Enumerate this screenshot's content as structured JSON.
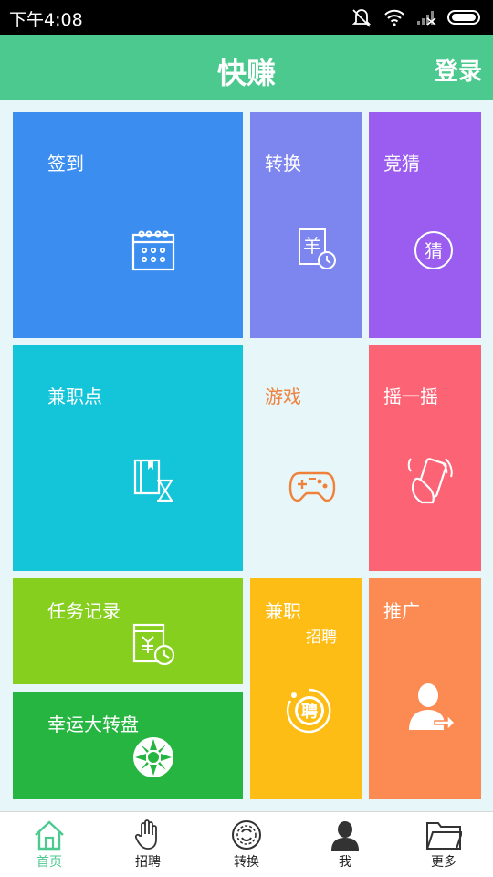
{
  "status_bar": {
    "time": "下午4:08"
  },
  "header": {
    "title": "快赚",
    "login": "登录"
  },
  "tiles": {
    "sign_in": {
      "label": "签到"
    },
    "convert": {
      "label": "转换",
      "icon_char": "羊"
    },
    "guess": {
      "label": "竞猜",
      "icon_char": "猜"
    },
    "points": {
      "label": "兼职点"
    },
    "game": {
      "label": "游戏"
    },
    "shake": {
      "label": "摇一摇"
    },
    "tasks": {
      "label": "任务记录"
    },
    "part_time": {
      "label": "兼职",
      "sublabel": "招聘",
      "icon_char": "聘"
    },
    "promote": {
      "label": "推广"
    },
    "wheel": {
      "label": "幸运大转盘"
    }
  },
  "bottom_nav": [
    {
      "label": "首页",
      "icon": "home-icon",
      "active": true
    },
    {
      "label": "招聘",
      "icon": "hand-icon"
    },
    {
      "label": "转换",
      "icon": "coin-icon"
    },
    {
      "label": "我",
      "icon": "user-icon"
    },
    {
      "label": "更多",
      "icon": "folder-icon"
    }
  ],
  "colors": {
    "accent": "#4cc98f",
    "sign_in": "#3b8ef0",
    "convert": "#7d85ef",
    "guess": "#9b5def",
    "points": "#14c4d9",
    "game_text": "#f0813a",
    "shake": "#fc6476",
    "tasks": "#86cf1e",
    "part_time": "#fdbd14",
    "promote": "#fc8a53",
    "wheel": "#27b542"
  }
}
